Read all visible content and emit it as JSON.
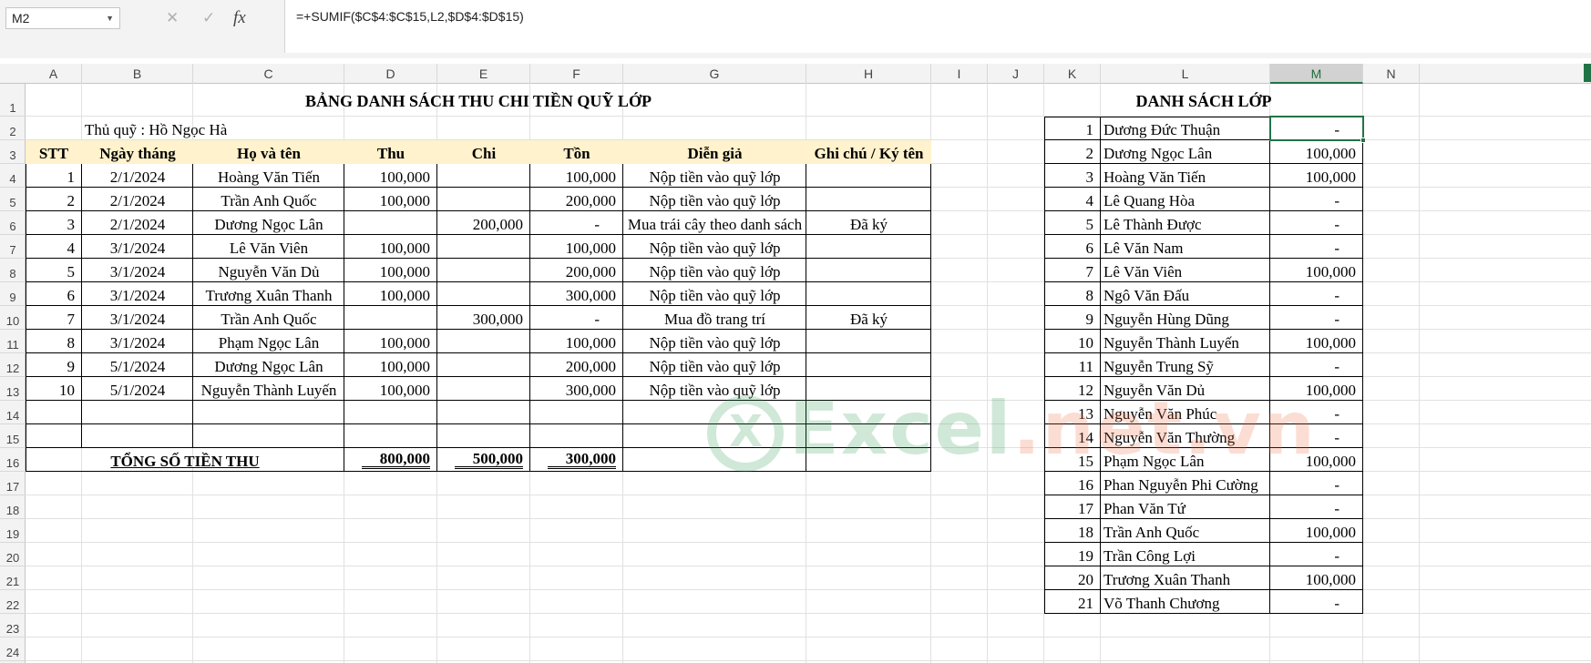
{
  "formula_bar": {
    "name_box": "M2",
    "cancel_icon": "✕",
    "enter_icon": "✓",
    "fx_label": "fx",
    "formula": "=+SUMIF($C$4:$C$15,L2,$D$4:$D$15)"
  },
  "columns": [
    "A",
    "B",
    "C",
    "D",
    "E",
    "F",
    "G",
    "H",
    "I",
    "J",
    "K",
    "L",
    "M",
    "N"
  ],
  "rows": [
    "1",
    "2",
    "3",
    "4",
    "5",
    "6",
    "7",
    "8",
    "9",
    "10",
    "11",
    "12",
    "13",
    "14",
    "15",
    "16",
    "17",
    "18",
    "19",
    "20",
    "21",
    "22",
    "23",
    "24"
  ],
  "selected_column": "M",
  "selected_cell": "M2",
  "left_table": {
    "title": "BẢNG DANH SÁCH THU CHI TIỀN QUỸ LỚP",
    "treasurer": "Thủ quỹ : Hồ Ngọc Hà",
    "headers": [
      "STT",
      "Ngày tháng",
      "Họ và tên",
      "Thu",
      "Chi",
      "Tồn",
      "Diễn giả",
      "Ghi chú / Ký tên"
    ],
    "rows": [
      [
        "1",
        "2/1/2024",
        "Hoàng Văn Tiến",
        "100,000",
        "",
        "100,000",
        "Nộp tiền vào quỹ lớp",
        ""
      ],
      [
        "2",
        "2/1/2024",
        "Trần Anh Quốc",
        "100,000",
        "",
        "200,000",
        "Nộp tiền vào quỹ lớp",
        ""
      ],
      [
        "3",
        "2/1/2024",
        "Dương Ngọc Lân",
        "",
        "200,000",
        "-",
        "Mua trái cây theo danh sách",
        "Đã ký"
      ],
      [
        "4",
        "3/1/2024",
        "Lê Văn Viên",
        "100,000",
        "",
        "100,000",
        "Nộp tiền vào quỹ lớp",
        ""
      ],
      [
        "5",
        "3/1/2024",
        "Nguyễn Văn Dủ",
        "100,000",
        "",
        "200,000",
        "Nộp tiền vào quỹ lớp",
        ""
      ],
      [
        "6",
        "3/1/2024",
        "Trương Xuân Thanh",
        "100,000",
        "",
        "300,000",
        "Nộp tiền vào quỹ lớp",
        ""
      ],
      [
        "7",
        "3/1/2024",
        "Trần Anh Quốc",
        "",
        "300,000",
        "-",
        "Mua đồ trang trí",
        "Đã ký"
      ],
      [
        "8",
        "3/1/2024",
        "Phạm Ngọc Lân",
        "100,000",
        "",
        "100,000",
        "Nộp tiền vào quỹ lớp",
        ""
      ],
      [
        "9",
        "5/1/2024",
        "Dương Ngọc Lân",
        "100,000",
        "",
        "200,000",
        "Nộp tiền vào quỹ lớp",
        ""
      ],
      [
        "10",
        "5/1/2024",
        "Nguyễn Thành Luyến",
        "100,000",
        "",
        "300,000",
        "Nộp tiền vào quỹ lớp",
        ""
      ]
    ],
    "total_label": "TỔNG SỐ TIỀN THU",
    "total_thu": "800,000",
    "total_chi": "500,000",
    "total_ton": "300,000"
  },
  "right_table": {
    "title": "DANH SÁCH LỚP",
    "rows": [
      [
        "1",
        "Dương Đức Thuận",
        "-"
      ],
      [
        "2",
        "Dương Ngọc Lân",
        "100,000"
      ],
      [
        "3",
        "Hoàng Văn Tiến",
        "100,000"
      ],
      [
        "4",
        "Lê Quang Hòa",
        "-"
      ],
      [
        "5",
        "Lê Thành Được",
        "-"
      ],
      [
        "6",
        "Lê Văn Nam",
        "-"
      ],
      [
        "7",
        "Lê Văn Viên",
        "100,000"
      ],
      [
        "8",
        "Ngô Văn Đấu",
        "-"
      ],
      [
        "9",
        "Nguyễn Hùng Dũng",
        "-"
      ],
      [
        "10",
        "Nguyễn Thành Luyến",
        "100,000"
      ],
      [
        "11",
        "Nguyễn Trung Sỹ",
        "-"
      ],
      [
        "12",
        "Nguyễn Văn Dủ",
        "100,000"
      ],
      [
        "13",
        "Nguyễn Văn Phúc",
        "-"
      ],
      [
        "14",
        "Nguyễn Văn Thường",
        "-"
      ],
      [
        "15",
        "Phạm Ngọc Lân",
        "100,000"
      ],
      [
        "16",
        "Phan Nguyễn Phi Cường",
        "-"
      ],
      [
        "17",
        "Phan Văn Tứ",
        "-"
      ],
      [
        "18",
        "Trần Anh Quốc",
        "100,000"
      ],
      [
        "19",
        "Trần Công Lợi",
        "-"
      ],
      [
        "20",
        "Trương Xuân Thanh",
        "100,000"
      ],
      [
        "21",
        "Võ Thanh Chương",
        "-"
      ]
    ]
  },
  "watermark": {
    "part1": "Excel",
    "part2": ".net.vn"
  },
  "colors": {
    "header_fill": "#fff2cc",
    "excel_green": "#217346"
  }
}
